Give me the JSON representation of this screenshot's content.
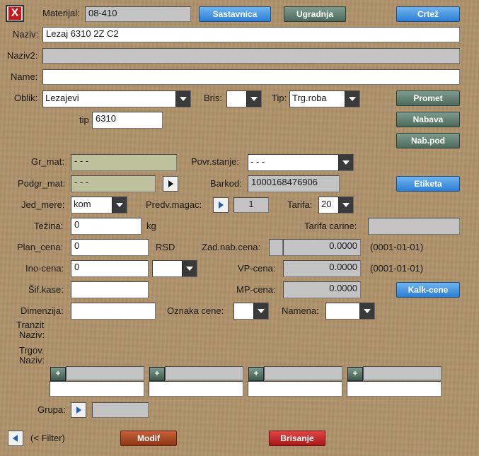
{
  "header": {
    "close_icon_label": "X",
    "material_label": "Materijal:",
    "material_value": "08-410",
    "sastavnica_button": "Sastavnica",
    "ugradnja_button": "Ugradnja",
    "crtez_button": "Crtež"
  },
  "naziv": {
    "label": "Naziv:",
    "value": "Lezaj 6310 2Z C2"
  },
  "naziv2": {
    "label": "Naziv2:",
    "value": ""
  },
  "name": {
    "label": "Name:",
    "value": ""
  },
  "oblik": {
    "label": "Oblik:",
    "value": "Lezajevi"
  },
  "bris": {
    "label": "Bris:",
    "value": ""
  },
  "tip_select": {
    "label": "Tip:",
    "value": "Trg.roba"
  },
  "tip": {
    "label": "tip",
    "value": "6310"
  },
  "side_buttons": {
    "promet": "Promet",
    "nabava": "Nabava",
    "nabpod": "Nab.pod"
  },
  "gr_mat": {
    "label": "Gr_mat:",
    "value": "- - -"
  },
  "povr_stanje": {
    "label": "Povr.stanje:",
    "value": "- - -"
  },
  "podgr_mat": {
    "label": "Podgr_mat:",
    "value": "- - -"
  },
  "barkod": {
    "label": "Barkod:",
    "value": "1000168476906"
  },
  "etiketa_button": "Etiketa",
  "jed_mere": {
    "label": "Jed_mere:",
    "value": "kom"
  },
  "predv_magac": {
    "label": "Predv.magac:",
    "value": "1"
  },
  "tarifa": {
    "label": "Tarifa:",
    "value": "20"
  },
  "tezina": {
    "label": "Težina:",
    "value": "0",
    "unit": "kg"
  },
  "tarifa_carine": {
    "label": "Tarifa carine:",
    "value": ""
  },
  "plan_cena": {
    "label": "Plan_cena:",
    "value": "0",
    "unit": "RSD"
  },
  "zad_nab_cena": {
    "label": "Zad.nab.cena:",
    "value": "0.0000",
    "date": "(0001-01-01)"
  },
  "ino_cena": {
    "label": "Ino-cena:",
    "value": "0",
    "currency": ""
  },
  "vp_cena": {
    "label": "VP-cena:",
    "value": "0.0000",
    "date": "(0001-01-01)"
  },
  "sif_kase": {
    "label": "Šif.kase:",
    "value": ""
  },
  "mp_cena": {
    "label": "MP-cena:",
    "value": "0.0000"
  },
  "kalk_button": "Kalk-cene",
  "dimenzija": {
    "label": "Dimenzija:",
    "value": ""
  },
  "oznaka_cene": {
    "label": "Oznaka cene:",
    "value": ""
  },
  "namena": {
    "label": "Namena:",
    "value": ""
  },
  "tranzit": {
    "label_line1": "Tranzit",
    "label_line2": "Naziv:"
  },
  "trgov": {
    "label_line1": "Trgov.",
    "label_line2": "Naziv:"
  },
  "extra_groups": [
    {
      "plus": "+",
      "header": "",
      "value": ""
    },
    {
      "plus": "+",
      "header": "",
      "value": ""
    },
    {
      "plus": "+",
      "header": "",
      "value": ""
    },
    {
      "plus": "+",
      "header": "",
      "value": ""
    }
  ],
  "grupa": {
    "label": "Grupa:",
    "value": ""
  },
  "footer": {
    "filter_label": "(< Filter)",
    "modif_button": "Modif",
    "brisanje_button": "Brisanje"
  }
}
